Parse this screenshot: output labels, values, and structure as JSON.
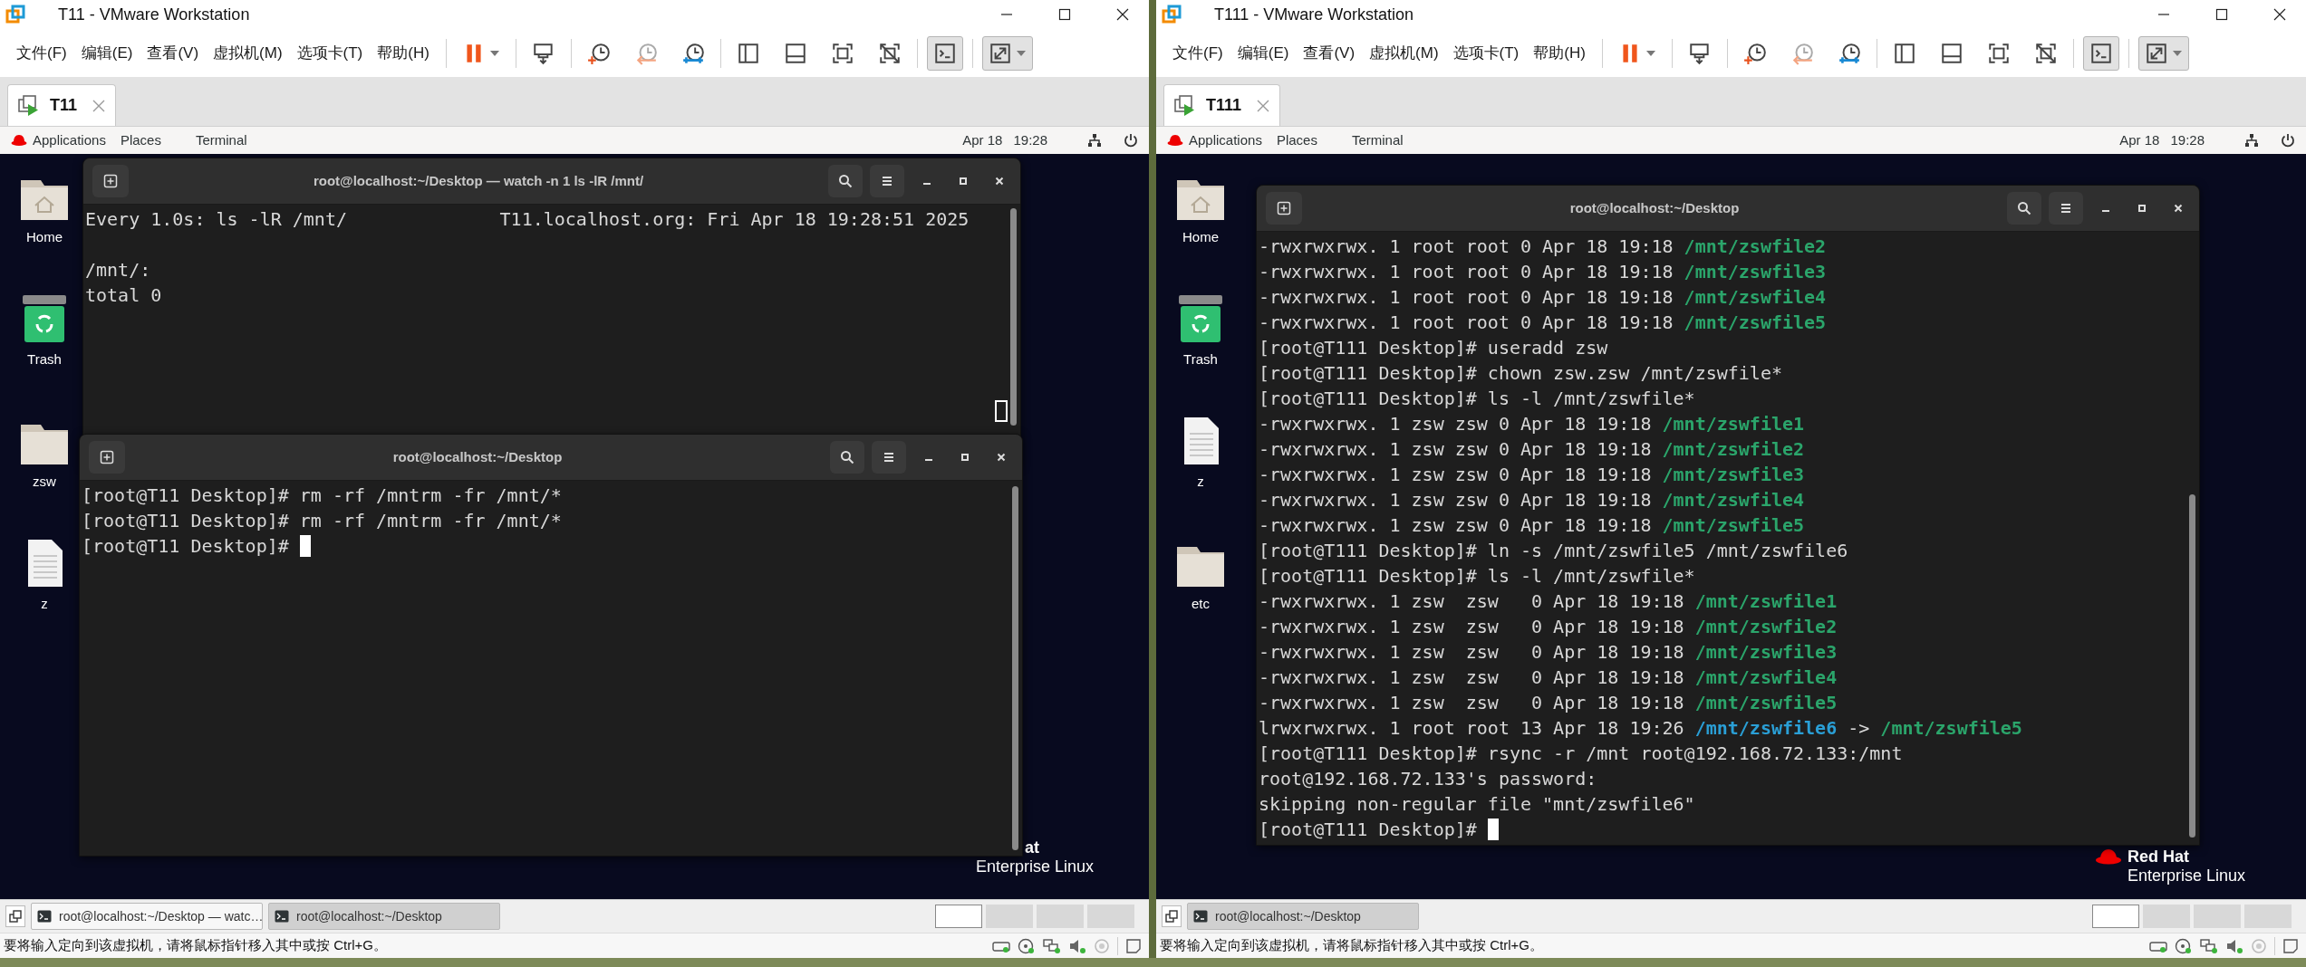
{
  "windows": [
    {
      "title": "T11 - VMware Workstation",
      "menus": [
        "文件(F)",
        "编辑(E)",
        "查看(V)",
        "虚拟机(M)",
        "选项卡(T)",
        "帮助(H)"
      ],
      "toolbar": [
        [
          {
            "kind": "pause",
            "selected": false
          }
        ],
        [
          {
            "kind": "send-keys",
            "selected": false
          }
        ],
        [
          {
            "kind": "snapshot",
            "selected": false
          },
          {
            "kind": "revert",
            "selected": false
          },
          {
            "kind": "manager",
            "selected": false
          }
        ],
        [
          {
            "kind": "sidebar",
            "selected": false
          },
          {
            "kind": "thumbnail",
            "selected": false
          },
          {
            "kind": "fit",
            "selected": false
          },
          {
            "kind": "no-fit",
            "selected": false
          }
        ],
        [
          {
            "kind": "console",
            "selected": true
          }
        ],
        [
          {
            "kind": "fullscreen",
            "selected": true
          }
        ]
      ],
      "tabs": [
        {
          "label": "T11",
          "selected": true
        }
      ],
      "top_bar": {
        "menus": [
          "Applications",
          "Places",
          "Terminal"
        ],
        "date": "Apr 18",
        "time": "19:28"
      },
      "desktop_icons": [
        {
          "label": "Home",
          "kind": "home"
        },
        {
          "label": "Trash",
          "kind": "trash"
        },
        {
          "label": "zsw",
          "kind": "folder"
        },
        {
          "label": "z",
          "kind": "file"
        }
      ],
      "brand": {
        "name": "at",
        "subtitle": "Enterprise Linux"
      },
      "terminals": [
        {
          "title": "root@localhost:~/Desktop — watch -n 1 ls -lR /mnt/",
          "kind": "watch",
          "lines": [
            {
              "segments": [
                {
                  "text": "Every 1.0s: ls -lR /mnt/              T11.localhost.org: Fri Apr 18 19:28:51 2025"
                }
              ]
            },
            {
              "segments": [
                {
                  "text": "/mnt/:"
                }
              ],
              "spacer_before": true
            },
            {
              "segments": [
                {
                  "text": "total 0"
                }
              ]
            }
          ]
        },
        {
          "title": "root@localhost:~/Desktop",
          "kind": "shell",
          "lines": [
            {
              "segments": [
                {
                  "text": "[root@T11 Desktop]# rm -rf /mntrm -fr /mnt/*"
                }
              ]
            },
            {
              "segments": [
                {
                  "text": "[root@T11 Desktop]# rm -rf /mntrm -fr /mnt/*"
                }
              ]
            },
            {
              "segments": [
                {
                  "text": "[root@T11 Desktop]# "
                }
              ],
              "cursor": true
            }
          ]
        }
      ],
      "taskbar": {
        "tasks": [
          {
            "label": "root@localhost:~/Desktop — watc…",
            "selected": false
          },
          {
            "label": "root@localhost:~/Desktop",
            "selected": true
          }
        ],
        "workspaces": [
          {
            "selected": true
          },
          {
            "selected": false
          },
          {
            "selected": false
          },
          {
            "selected": false
          }
        ]
      },
      "status_message": "要将输入定向到该虚拟机，请将鼠标指针移入其中或按 Ctrl+G。"
    },
    {
      "title": "T111 - VMware Workstation",
      "menus": [
        "文件(F)",
        "编辑(E)",
        "查看(V)",
        "虚拟机(M)",
        "选项卡(T)",
        "帮助(H)"
      ],
      "toolbar": [
        [
          {
            "kind": "pause",
            "selected": false
          }
        ],
        [
          {
            "kind": "send-keys",
            "selected": false
          }
        ],
        [
          {
            "kind": "snapshot",
            "selected": false
          },
          {
            "kind": "revert",
            "selected": false
          },
          {
            "kind": "manager",
            "selected": false
          }
        ],
        [
          {
            "kind": "sidebar",
            "selected": false
          },
          {
            "kind": "thumbnail",
            "selected": false
          },
          {
            "kind": "fit",
            "selected": false
          },
          {
            "kind": "no-fit",
            "selected": false
          }
        ],
        [
          {
            "kind": "console",
            "selected": true
          }
        ],
        [
          {
            "kind": "fullscreen",
            "selected": true
          }
        ]
      ],
      "tabs": [
        {
          "label": "T111",
          "selected": true
        }
      ],
      "top_bar": {
        "menus": [
          "Applications",
          "Places",
          "Terminal"
        ],
        "date": "Apr 18",
        "time": "19:28"
      },
      "desktop_icons": [
        {
          "label": "Home",
          "kind": "home"
        },
        {
          "label": "Trash",
          "kind": "trash"
        },
        {
          "label": "z",
          "kind": "file"
        },
        {
          "label": "etc",
          "kind": "folder"
        }
      ],
      "brand": {
        "name": "Red Hat",
        "subtitle": "Enterprise Linux",
        "logo": true
      },
      "terminals": [
        {
          "title": "root@localhost:~/Desktop",
          "kind": "shell",
          "lines": [
            {
              "segments": [
                {
                  "text": "-rwxrwxrwx. 1 root root 0 Apr 18 19:18 "
                },
                {
                  "text": "/mnt/zswfile2",
                  "kind": "file"
                }
              ]
            },
            {
              "segments": [
                {
                  "text": "-rwxrwxrwx. 1 root root 0 Apr 18 19:18 "
                },
                {
                  "text": "/mnt/zswfile3",
                  "kind": "file"
                }
              ]
            },
            {
              "segments": [
                {
                  "text": "-rwxrwxrwx. 1 root root 0 Apr 18 19:18 "
                },
                {
                  "text": "/mnt/zswfile4",
                  "kind": "file"
                }
              ]
            },
            {
              "segments": [
                {
                  "text": "-rwxrwxrwx. 1 root root 0 Apr 18 19:18 "
                },
                {
                  "text": "/mnt/zswfile5",
                  "kind": "file"
                }
              ]
            },
            {
              "segments": [
                {
                  "text": "[root@T111 Desktop]# useradd zsw"
                }
              ]
            },
            {
              "segments": [
                {
                  "text": "[root@T111 Desktop]# chown zsw.zsw /mnt/zswfile*"
                }
              ]
            },
            {
              "segments": [
                {
                  "text": "[root@T111 Desktop]# ls -l /mnt/zswfile*"
                }
              ]
            },
            {
              "segments": [
                {
                  "text": "-rwxrwxrwx. 1 zsw zsw 0 Apr 18 19:18 "
                },
                {
                  "text": "/mnt/zswfile1",
                  "kind": "file"
                }
              ]
            },
            {
              "segments": [
                {
                  "text": "-rwxrwxrwx. 1 zsw zsw 0 Apr 18 19:18 "
                },
                {
                  "text": "/mnt/zswfile2",
                  "kind": "file"
                }
              ]
            },
            {
              "segments": [
                {
                  "text": "-rwxrwxrwx. 1 zsw zsw 0 Apr 18 19:18 "
                },
                {
                  "text": "/mnt/zswfile3",
                  "kind": "file"
                }
              ]
            },
            {
              "segments": [
                {
                  "text": "-rwxrwxrwx. 1 zsw zsw 0 Apr 18 19:18 "
                },
                {
                  "text": "/mnt/zswfile4",
                  "kind": "file"
                }
              ]
            },
            {
              "segments": [
                {
                  "text": "-rwxrwxrwx. 1 zsw zsw 0 Apr 18 19:18 "
                },
                {
                  "text": "/mnt/zswfile5",
                  "kind": "file"
                }
              ]
            },
            {
              "segments": [
                {
                  "text": "[root@T111 Desktop]# ln -s /mnt/zswfile5 /mnt/zswfile6"
                }
              ]
            },
            {
              "segments": [
                {
                  "text": "[root@T111 Desktop]# ls -l /mnt/zswfile*"
                }
              ]
            },
            {
              "segments": [
                {
                  "text": "-rwxrwxrwx. 1 zsw  zsw   0 Apr 18 19:18 "
                },
                {
                  "text": "/mnt/zswfile1",
                  "kind": "file"
                }
              ]
            },
            {
              "segments": [
                {
                  "text": "-rwxrwxrwx. 1 zsw  zsw   0 Apr 18 19:18 "
                },
                {
                  "text": "/mnt/zswfile2",
                  "kind": "file"
                }
              ]
            },
            {
              "segments": [
                {
                  "text": "-rwxrwxrwx. 1 zsw  zsw   0 Apr 18 19:18 "
                },
                {
                  "text": "/mnt/zswfile3",
                  "kind": "file"
                }
              ]
            },
            {
              "segments": [
                {
                  "text": "-rwxrwxrwx. 1 zsw  zsw   0 Apr 18 19:18 "
                },
                {
                  "text": "/mnt/zswfile4",
                  "kind": "file"
                }
              ]
            },
            {
              "segments": [
                {
                  "text": "-rwxrwxrwx. 1 zsw  zsw   0 Apr 18 19:18 "
                },
                {
                  "text": "/mnt/zswfile5",
                  "kind": "file"
                }
              ]
            },
            {
              "segments": [
                {
                  "text": "lrwxrwxrwx. 1 root root 13 Apr 18 19:26 "
                },
                {
                  "text": "/mnt/zswfile6",
                  "kind": "link"
                },
                {
                  "text": " -> "
                },
                {
                  "text": "/mnt/zswfile5",
                  "kind": "file"
                }
              ]
            },
            {
              "segments": [
                {
                  "text": "[root@T111 Desktop]# rsync -r /mnt root@192.168.72.133:/mnt"
                }
              ]
            },
            {
              "segments": [
                {
                  "text": "root@192.168.72.133's password:"
                }
              ]
            },
            {
              "segments": [
                {
                  "text": "skipping non-regular file \"mnt/zswfile6\""
                }
              ]
            },
            {
              "segments": [
                {
                  "text": "[root@T111 Desktop]# "
                }
              ],
              "cursor": true
            }
          ]
        }
      ],
      "taskbar": {
        "tasks": [
          {
            "label": "root@localhost:~/Desktop",
            "selected": true
          }
        ],
        "workspaces": [
          {
            "selected": true
          },
          {
            "selected": false
          },
          {
            "selected": false
          },
          {
            "selected": false
          }
        ]
      },
      "status_message": "要将输入定向到该虚拟机，请将鼠标指针移入其中或按 Ctrl+G。"
    }
  ]
}
